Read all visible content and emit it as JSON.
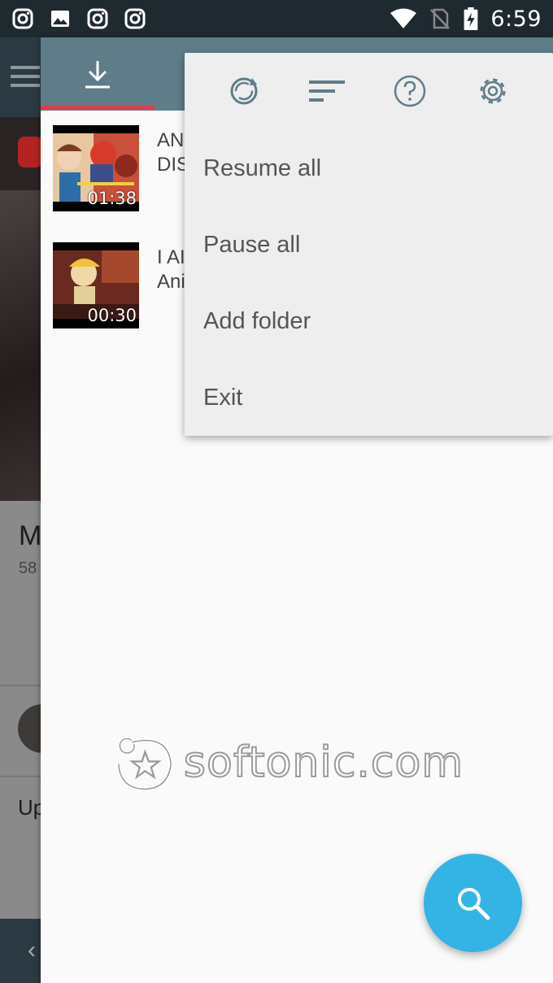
{
  "status_bar": {
    "time": "6:59",
    "left_icons": [
      "instagram-icon",
      "image-icon",
      "instagram-icon",
      "instagram-icon"
    ],
    "right_icons": [
      "wifi-icon",
      "no-sim-icon",
      "battery-charging-icon"
    ]
  },
  "background_app": {
    "heading_partial": "M",
    "subtext_partial": "58",
    "section_partial": "Up"
  },
  "drawer": {
    "active_tab": "download-icon",
    "accent_color": "#e5394b",
    "toolbar_color": "#5f7d89"
  },
  "videos": [
    {
      "title_line1": "AN",
      "title_line2": "DIS",
      "duration": "01:38"
    },
    {
      "title_line1": "I AI",
      "title_line2": "Ani",
      "duration": "00:30"
    }
  ],
  "popup_menu": {
    "icons": [
      "refresh-icon",
      "sort-icon",
      "help-icon",
      "settings-icon"
    ],
    "items": [
      "Resume all",
      "Pause all",
      "Add folder",
      "Exit"
    ]
  },
  "watermark": {
    "text": "softonic.com"
  },
  "fab": {
    "icon": "search-icon",
    "color": "#34b3e5"
  }
}
